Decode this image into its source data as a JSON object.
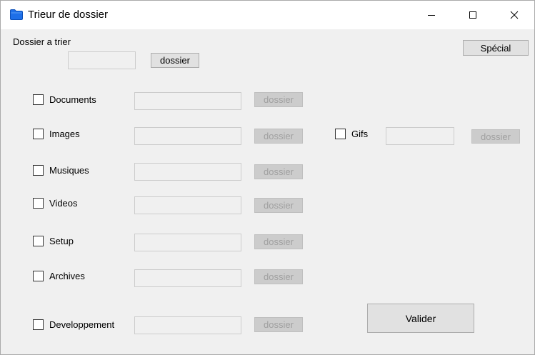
{
  "window": {
    "title": "Trieur de dossier",
    "controls": [
      "minimize-icon",
      "maximize-icon",
      "close-icon"
    ]
  },
  "source": {
    "label": "Dossier a trier",
    "path_value": "",
    "browse_label": "dossier"
  },
  "special_label": "Spécial",
  "categories": [
    {
      "label": "Documents",
      "checked": false,
      "path": "",
      "browse_label": "dossier",
      "enabled": false
    },
    {
      "label": "Images",
      "checked": false,
      "path": "",
      "browse_label": "dossier",
      "enabled": false
    },
    {
      "label": "Musiques",
      "checked": false,
      "path": "",
      "browse_label": "dossier",
      "enabled": false
    },
    {
      "label": "Videos",
      "checked": false,
      "path": "",
      "browse_label": "dossier",
      "enabled": false
    },
    {
      "label": "Setup",
      "checked": false,
      "path": "",
      "browse_label": "dossier",
      "enabled": false
    },
    {
      "label": "Archives",
      "checked": false,
      "path": "",
      "browse_label": "dossier",
      "enabled": false
    },
    {
      "label": "Developpement",
      "checked": false,
      "path": "",
      "browse_label": "dossier",
      "enabled": false
    }
  ],
  "gifs": {
    "label": "Gifs",
    "checked": false,
    "path": "",
    "browse_label": "dossier",
    "enabled": false
  },
  "validate_label": "Valider",
  "colors": {
    "folder_icon": "#1e6fe8",
    "disabled_text": "#a0a0a0",
    "window_bg": "#f0f0f0"
  }
}
